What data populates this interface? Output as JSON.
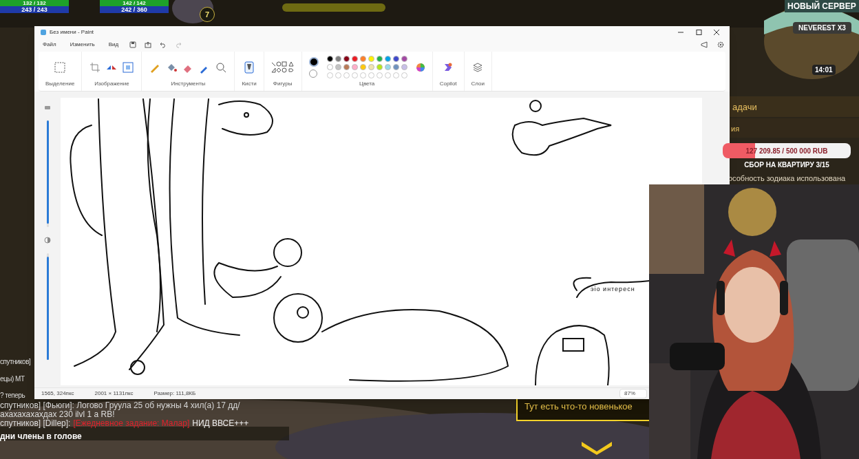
{
  "hud": {
    "party": [
      {
        "health": "132 / 132",
        "mana": "243 / 243"
      },
      {
        "health": "142 / 142",
        "mana": "242 / 360"
      }
    ],
    "level_badge": "7",
    "server_banner": "НОВЫЙ СЕРВЕР",
    "server_name": "NEVEREST X3",
    "clock": "14:01",
    "quest_header": "адачи",
    "quest_sub": "ия",
    "zodiac_note": "особность зодиака использована",
    "new_notice": "Тут есть что-то новенькое"
  },
  "chat": {
    "edge_lines": [
      "спутников]",
      "ецы) МТ",
      "? теперь"
    ],
    "lines": [
      {
        "text": "спутников] [Фьюги]: Логово Груула 25 об нужны 4 хил(а) 17 дд/",
        "kind": "normal"
      },
      {
        "text": "ахахахахахдах 230 ilvl 1 а RB!",
        "kind": "normal"
      },
      {
        "text": "спутников] [Dillep]:",
        "link": "[Ежедневное задание: Малар]",
        "after": "НИД ВВСЕ+++",
        "kind": "link"
      },
      {
        "text": "дни члены в голове",
        "kind": "bold"
      }
    ]
  },
  "window": {
    "title": "Без имени - Paint"
  },
  "menu": [
    "Файл",
    "Изменить",
    "Вид"
  ],
  "ribbon_groups": [
    "Выделение",
    "Изображение",
    "Инструменты",
    "Кисти",
    "Фигуры",
    "Цвета",
    "Copilot",
    "Слои"
  ],
  "colors": {
    "current": [
      {
        "color": "#000000"
      },
      {
        "color": "#ffffff"
      }
    ],
    "swatches": [
      {
        "kind": "color",
        "color": "#000000"
      },
      {
        "kind": "color",
        "color": "#7f7f7f"
      },
      {
        "kind": "color",
        "color": "#880015"
      },
      {
        "kind": "color",
        "color": "#ed1c24"
      },
      {
        "kind": "color",
        "color": "#ff7f27"
      },
      {
        "kind": "color",
        "color": "#fff200"
      },
      {
        "kind": "color",
        "color": "#22b14c"
      },
      {
        "kind": "color",
        "color": "#00a2e8"
      },
      {
        "kind": "color",
        "color": "#3f48cc"
      },
      {
        "kind": "color",
        "color": "#a349a4"
      },
      {
        "kind": "color",
        "color": "#ffffff"
      },
      {
        "kind": "color",
        "color": "#c3c3c3"
      },
      {
        "kind": "color",
        "color": "#b97a57"
      },
      {
        "kind": "color",
        "color": "#ffaec9"
      },
      {
        "kind": "color",
        "color": "#ffc90e"
      },
      {
        "kind": "color",
        "color": "#efe4b0"
      },
      {
        "kind": "color",
        "color": "#b5e61d"
      },
      {
        "kind": "color",
        "color": "#99d9ea"
      },
      {
        "kind": "color",
        "color": "#7092be"
      },
      {
        "kind": "color",
        "color": "#c8bfe7"
      },
      {
        "kind": "empty"
      },
      {
        "kind": "empty"
      },
      {
        "kind": "empty"
      },
      {
        "kind": "empty"
      },
      {
        "kind": "empty"
      },
      {
        "kind": "empty"
      },
      {
        "kind": "empty"
      },
      {
        "kind": "empty"
      },
      {
        "kind": "empty"
      },
      {
        "kind": "empty"
      }
    ]
  },
  "sliders": [
    {
      "level": 0.97
    },
    {
      "level": 0.97
    }
  ],
  "canvas": {
    "speech_text": "эіо интересн"
  },
  "status_bar": {
    "cursor": "1565, 324пкс",
    "canvas_size": "2001 × 1131пкс",
    "file_size": "Размер: 111,8КБ",
    "zoom": "87%"
  },
  "donation": {
    "amount": "127 209.85 / 500 000 RUB",
    "level": 0.2544,
    "goal": "СБОР НА КВАРТИРУ 3/15"
  }
}
